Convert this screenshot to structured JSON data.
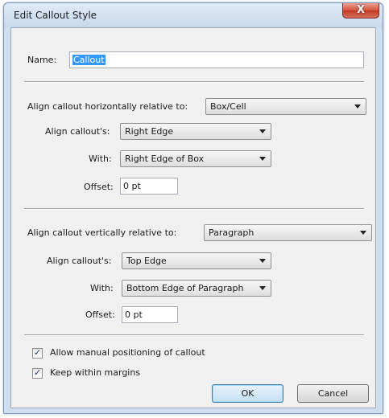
{
  "window": {
    "title": "Edit Callout Style",
    "close_glyph": "X"
  },
  "name_row": {
    "label": "Name:",
    "value": "Callout"
  },
  "horizontal": {
    "label": "Align callout horizontally relative to:",
    "relative_to": "Box/Cell",
    "align_label": "Align callout's:",
    "align_value": "Right Edge",
    "with_label": "With:",
    "with_value": "Right Edge of Box",
    "offset_label": "Offset:",
    "offset_value": "0 pt"
  },
  "vertical": {
    "label": "Align callout vertically relative to:",
    "relative_to": "Paragraph",
    "align_label": "Align callout's:",
    "align_value": "Top Edge",
    "with_label": "With:",
    "with_value": "Bottom Edge of Paragraph",
    "offset_label": "Offset:",
    "offset_value": "0 pt"
  },
  "options": {
    "allow_manual": {
      "label": "Allow manual positioning of callout",
      "checked": true
    },
    "keep_within_margins": {
      "label": "Keep within margins",
      "checked": true
    }
  },
  "buttons": {
    "ok": "OK",
    "cancel": "Cancel"
  },
  "icons": {
    "close": "close-icon",
    "dropdown": "chevron-down-icon",
    "check": "checkmark-icon"
  },
  "colors": {
    "selection": "#3399ff",
    "close_button": "#c9452f",
    "frame": "#cfdff0"
  }
}
